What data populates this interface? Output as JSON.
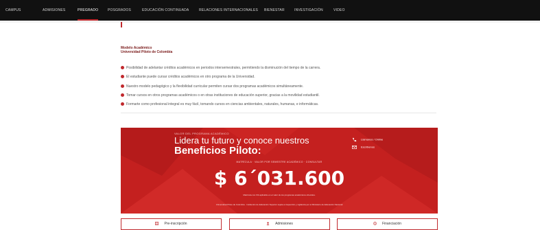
{
  "topnav": {
    "items": [
      "CAMPUS",
      "ADMISIONES",
      "PREGRADO",
      "POSGRADOS",
      "EDUCACIÓN CONTINUADA",
      "RELACIONES INTERNACIONALES",
      "BIENESTAR",
      "INVESTIGACIÓN",
      "VIDEO"
    ],
    "active_index": 2
  },
  "model": {
    "title_line1": "Modelo Académico",
    "title_line2": "Universidad Piloto de Colombia"
  },
  "features": [
    "Posibilidad de adelantar créditos académicos en periodos intersemestrales, permitiendo la disminución del tiempo de la carrera.",
    "El estudiante puede cursar créditos académicos en otro programa de la Universidad.",
    "Nuestro modelo pedagógico y la flexibilidad curricular permiten cursar dos programas académicos simultáneamente.",
    "Tomar cursos en otros programas académicos o en otras instituciones de educación superior, gracias a la movilidad estudiantil.",
    "Formarte como profesional integral es muy fácil, tomando cursos en ciencias ambientales, naturales, humanas, e informáticas."
  ],
  "banner": {
    "eyebrow": "VALOR DEL PROGRAMA ACADÉMICO",
    "headline": "Lidera tu futuro y conoce nuestros",
    "highlight": "Beneficios Piloto:",
    "contact_phone": "Llámanos / Online",
    "contact_email": "Escríbenos",
    "caption": "MATRÍCULA · VALOR POR SEMESTRE ACADÉMICO · CONSULTAR",
    "price": "$ 6´031.600",
    "fine_1": "Matrícula con IVA aplicable en el valor de los programas académicos ofrecidos.",
    "fine_2": "Universidad Piloto de Colombia · Institución de Educación Superior sujeta a inspección y vigilancia por el Ministerio de Educación Nacional",
    "colors": {
      "background": "#c4201f",
      "text": "#ffffff"
    }
  },
  "buttons": [
    {
      "label": "Pre-inscripción",
      "icon": "form-icon"
    },
    {
      "label": "Admisiones",
      "icon": "user-icon"
    },
    {
      "label": "Financiación",
      "icon": "dollar-icon"
    }
  ],
  "colors": {
    "accent": "#c0282c",
    "nav_bg": "#111111"
  }
}
